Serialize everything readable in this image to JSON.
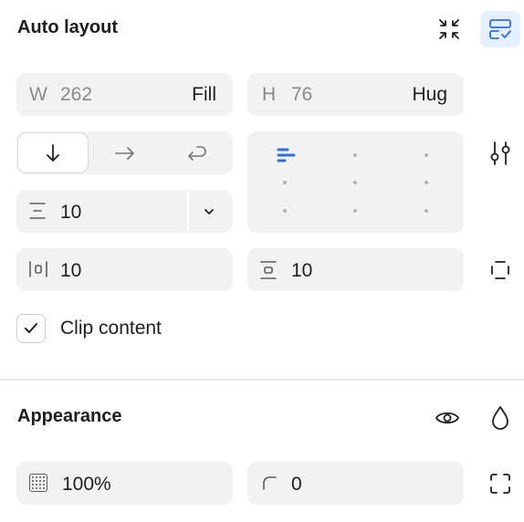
{
  "auto_layout": {
    "title": "Auto layout",
    "width": {
      "prefix": "W",
      "value": "262",
      "mode": "Fill"
    },
    "height": {
      "prefix": "H",
      "value": "76",
      "mode": "Hug"
    },
    "direction": {
      "selected": "vertical"
    },
    "gap": {
      "value": "10"
    },
    "horizontal_padding": {
      "value": "10"
    },
    "vertical_padding": {
      "value": "10"
    },
    "clip_content": {
      "label": "Clip content",
      "checked": true
    }
  },
  "appearance": {
    "title": "Appearance",
    "opacity": {
      "value": "100%"
    },
    "corner_radius": {
      "value": "0"
    }
  },
  "colors": {
    "accent": "#2d6fd9",
    "active_bg": "#e4efff",
    "field_bg": "#f2f2f2"
  },
  "icons": {
    "collapse": "collapse-arrows-icon",
    "layout_toggle": "layout-check-icon",
    "advanced": "sliders-icon",
    "padding_individual": "padding-individual-icon",
    "visibility": "eye-icon",
    "blend": "drop-icon",
    "corner_individual": "corners-icon"
  }
}
